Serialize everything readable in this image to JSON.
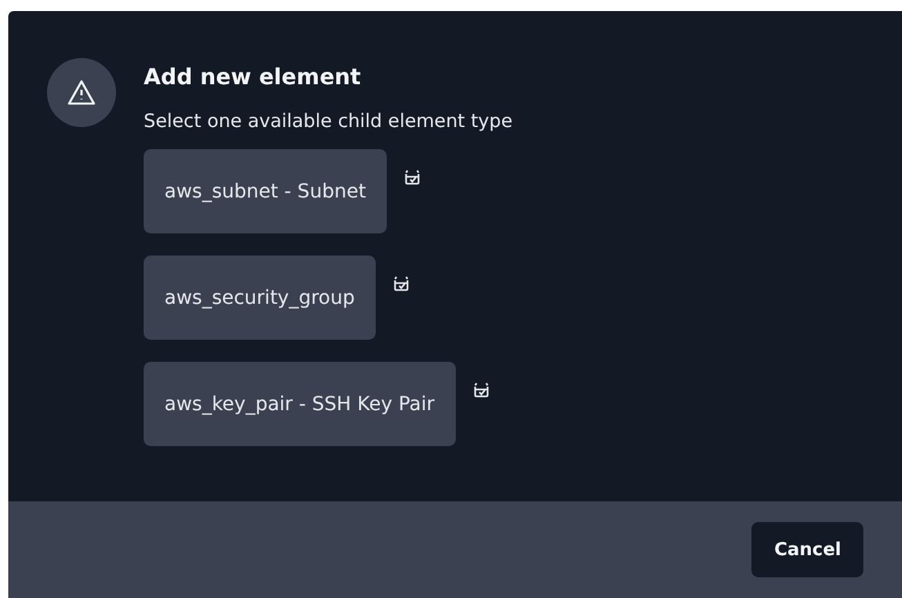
{
  "dialog": {
    "title": "Add new element",
    "message": "Select one available child element type",
    "options": [
      {
        "label": "aws_subnet - Subnet"
      },
      {
        "label": "aws_security_group"
      },
      {
        "label": "aws_key_pair - SSH Key Pair"
      }
    ],
    "buttons": [
      "Cancel"
    ]
  }
}
